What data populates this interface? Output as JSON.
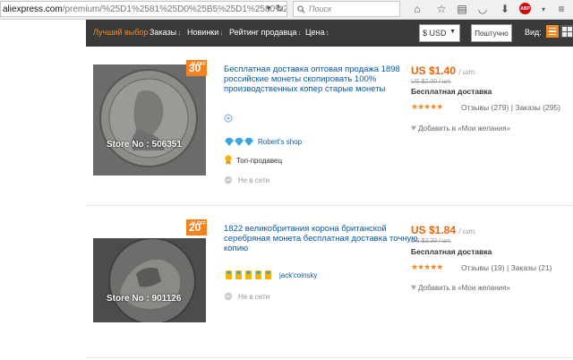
{
  "browser": {
    "url_host": "aliexpress.com",
    "url_path": "/premium/%25D1%2581%25D0%25B5%25D1%2580%25D0%25B5",
    "search_placeholder": "Поиск"
  },
  "nav": {
    "items": [
      {
        "label": "Лучший выбор",
        "active": true
      },
      {
        "label": "Заказы"
      },
      {
        "label": "Новинки"
      },
      {
        "label": "Рейтинг продавца"
      },
      {
        "label": "Цена"
      }
    ],
    "currency": "$ USD",
    "free_shipping": "Поштучно",
    "view_label": "Вид:"
  },
  "products": [
    {
      "discount": "30",
      "discount_off": "% OFF",
      "store_no": "Store No : 506351",
      "title": "Бесплатная доставка оптовая продажа 1898 российские монеты скопировать 100% производственных копер старые монеты",
      "seller": "Robert's shop",
      "top_seller": "Топ-продавец",
      "offline": "Не в сети",
      "price": "US $1.40",
      "price_unit": "/ шт.",
      "old_price": "US $2.00 / шт.",
      "shipping": "Бесплатная доставка",
      "reviews": "Отзывы (279)",
      "orders": "Заказы (295)",
      "wishlist": "Добавить в «Мои желания»",
      "rating": 5
    },
    {
      "discount": "20",
      "discount_off": "% OFF",
      "store_no": "Store No : 901126",
      "title": "1822 великобритания корона британской серебряная монета бесплатная доставка точную копию",
      "seller": "jack'coinsky",
      "offline": "Не в сети",
      "price": "US $1.84",
      "price_unit": "/ шт.",
      "old_price": "US $2.30 / шт.",
      "shipping": "Бесплатная доставка",
      "reviews": "Отзывы (19)",
      "orders": "Заказы (21)",
      "wishlist": "Добавить в «Мои желания»",
      "rating": 5
    }
  ],
  "stars_glyph": "★★★★★",
  "separator": "|"
}
